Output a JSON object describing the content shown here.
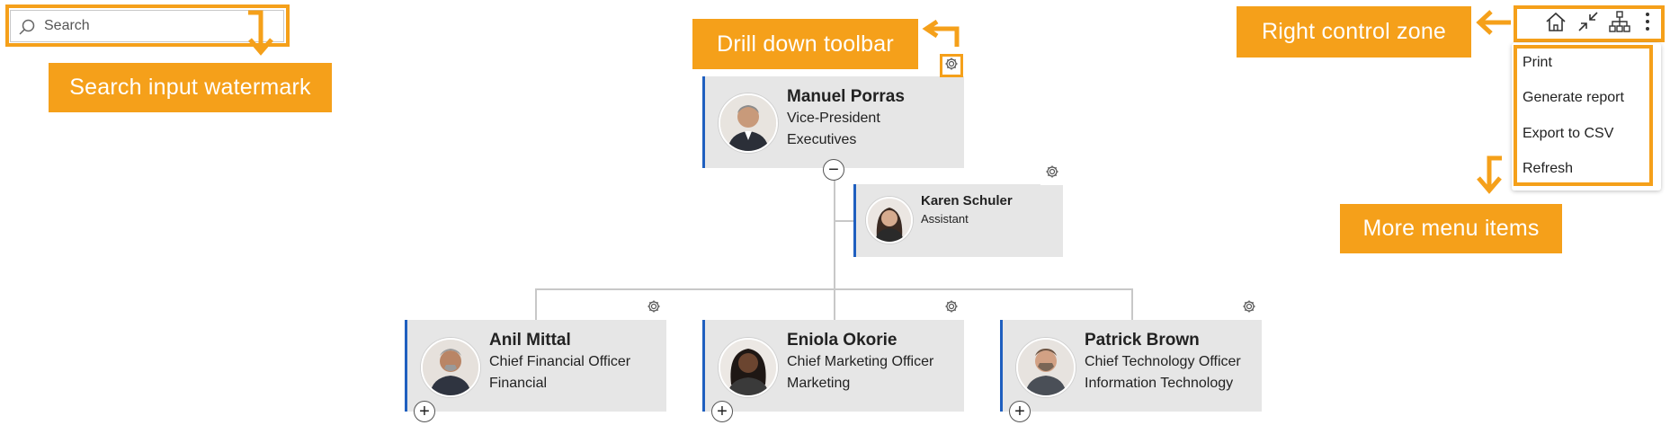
{
  "search": {
    "placeholder": "Search"
  },
  "callouts": {
    "search": "Search input watermark",
    "drill": "Drill down toolbar",
    "right_zone": "Right control zone",
    "more_menu": "More menu items"
  },
  "menu": {
    "items": [
      "Print",
      "Generate report",
      "Export to CSV",
      "Refresh"
    ]
  },
  "toolbar": {
    "icons": [
      "home-icon",
      "collapse-icon",
      "org-chart-icon",
      "more-vertical-icon"
    ]
  },
  "nodes": {
    "root": {
      "name": "Manuel Porras",
      "title": "Vice-President",
      "department": "Executives"
    },
    "assistant": {
      "name": "Karen Schuler",
      "title": "Assistant"
    },
    "children": [
      {
        "name": "Anil Mittal",
        "title": "Chief Financial Officer",
        "department": "Financial"
      },
      {
        "name": "Eniola Okorie",
        "title": "Chief Marketing Officer",
        "department": "Marketing"
      },
      {
        "name": "Patrick Brown",
        "title": "Chief Technology Officer",
        "department": "Information Technology"
      }
    ]
  },
  "colors": {
    "accent": "#f5a01a",
    "card_border": "#1f5fbf",
    "card_bg": "#e6e6e6"
  }
}
